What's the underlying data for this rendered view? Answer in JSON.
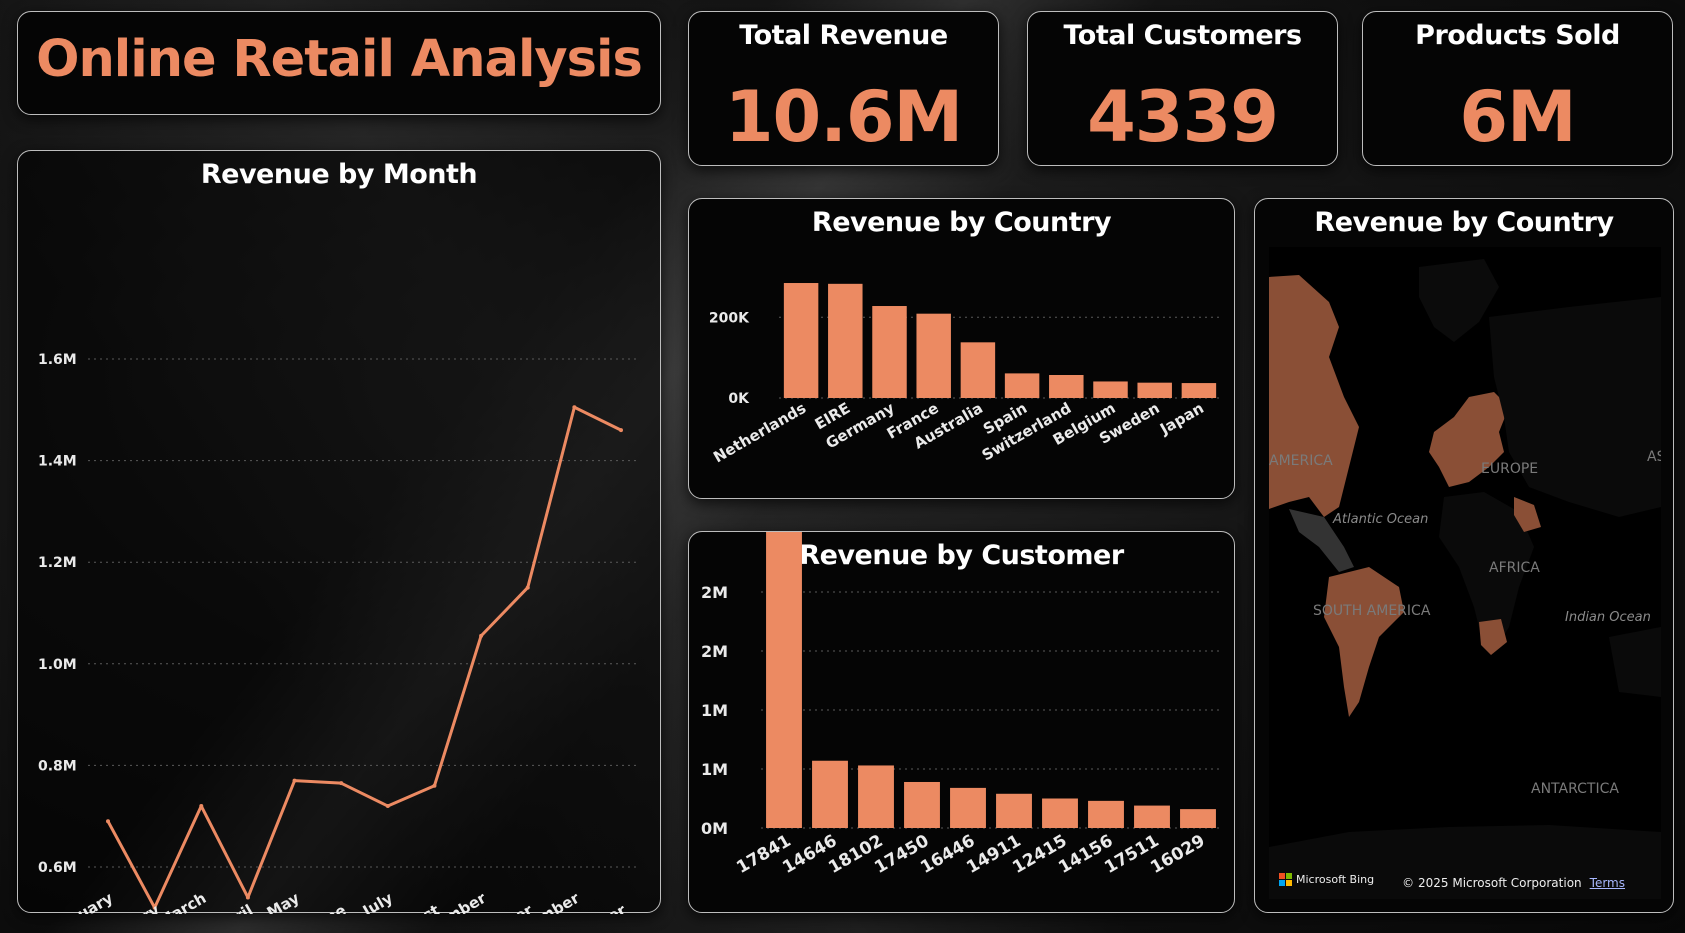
{
  "title": "Online Retail Analysis",
  "colors": {
    "accent": "#ec8a62",
    "text": "#ffffff",
    "grid": "#5a5a5a",
    "map_land": "#3a3a3a",
    "map_water": "#000000"
  },
  "kpis": [
    {
      "label": "Total Revenue",
      "value": "10.6M"
    },
    {
      "label": "Total Customers",
      "value": "4339"
    },
    {
      "label": "Products Sold",
      "value": "6M"
    }
  ],
  "map": {
    "title": "Revenue by Country",
    "labels": {
      "america": "AMERICA",
      "europe": "EUROPE",
      "asia": "AS",
      "africa": "AFRICA",
      "south_america": "SOUTH AMERICA",
      "antarctica": "ANTARCTICA"
    },
    "oceans": {
      "atlantic": "Atlantic Ocean",
      "indian": "Indian Ocean"
    },
    "footer": {
      "bing": "Microsoft Bing",
      "copyright": "© 2025 Microsoft Corporation",
      "terms": "Terms"
    }
  },
  "chart_data": [
    {
      "type": "line",
      "title": "Revenue by Month",
      "categories": [
        "January",
        "February",
        "March",
        "April",
        "May",
        "June",
        "July",
        "August",
        "September",
        "October",
        "November",
        "December"
      ],
      "values": [
        690000,
        520000,
        720000,
        540000,
        770000,
        765000,
        720000,
        760000,
        1055000,
        1150000,
        1505000,
        1460000
      ],
      "ylim": [
        550000,
        1650000
      ],
      "yticks": [
        600000,
        800000,
        1000000,
        1200000,
        1400000,
        1600000
      ],
      "ytick_labels": [
        "0.6M",
        "0.8M",
        "1.0M",
        "1.2M",
        "1.4M",
        "1.6M"
      ],
      "grid": true
    },
    {
      "type": "bar",
      "title": "Revenue by Country",
      "categories": [
        "Netherlands",
        "EIRE",
        "Germany",
        "France",
        "Australia",
        "Spain",
        "Switzerland",
        "Belgium",
        "Sweden",
        "Japan"
      ],
      "values": [
        285000,
        283000,
        228000,
        209000,
        138000,
        61000,
        57000,
        41000,
        38000,
        37000
      ],
      "ylim": [
        0,
        290000
      ],
      "yticks": [
        0,
        200000
      ],
      "ytick_labels": [
        "0K",
        "200K"
      ],
      "grid": true
    },
    {
      "type": "bar",
      "title": "Revenue by Customer",
      "categories": [
        "17841",
        "14646",
        "18102",
        "17450",
        "16446",
        "14911",
        "12415",
        "14156",
        "17511",
        "16029"
      ],
      "values": [
        2580000,
        570000,
        530000,
        390000,
        340000,
        290000,
        250000,
        230000,
        190000,
        160000
      ],
      "ylim": [
        0,
        2000000
      ],
      "yticks": [
        0,
        500000,
        1000000,
        1500000,
        2000000
      ],
      "ytick_labels": [
        "0M",
        "1M",
        "1M",
        "2M",
        "2M"
      ],
      "grid": true
    }
  ]
}
